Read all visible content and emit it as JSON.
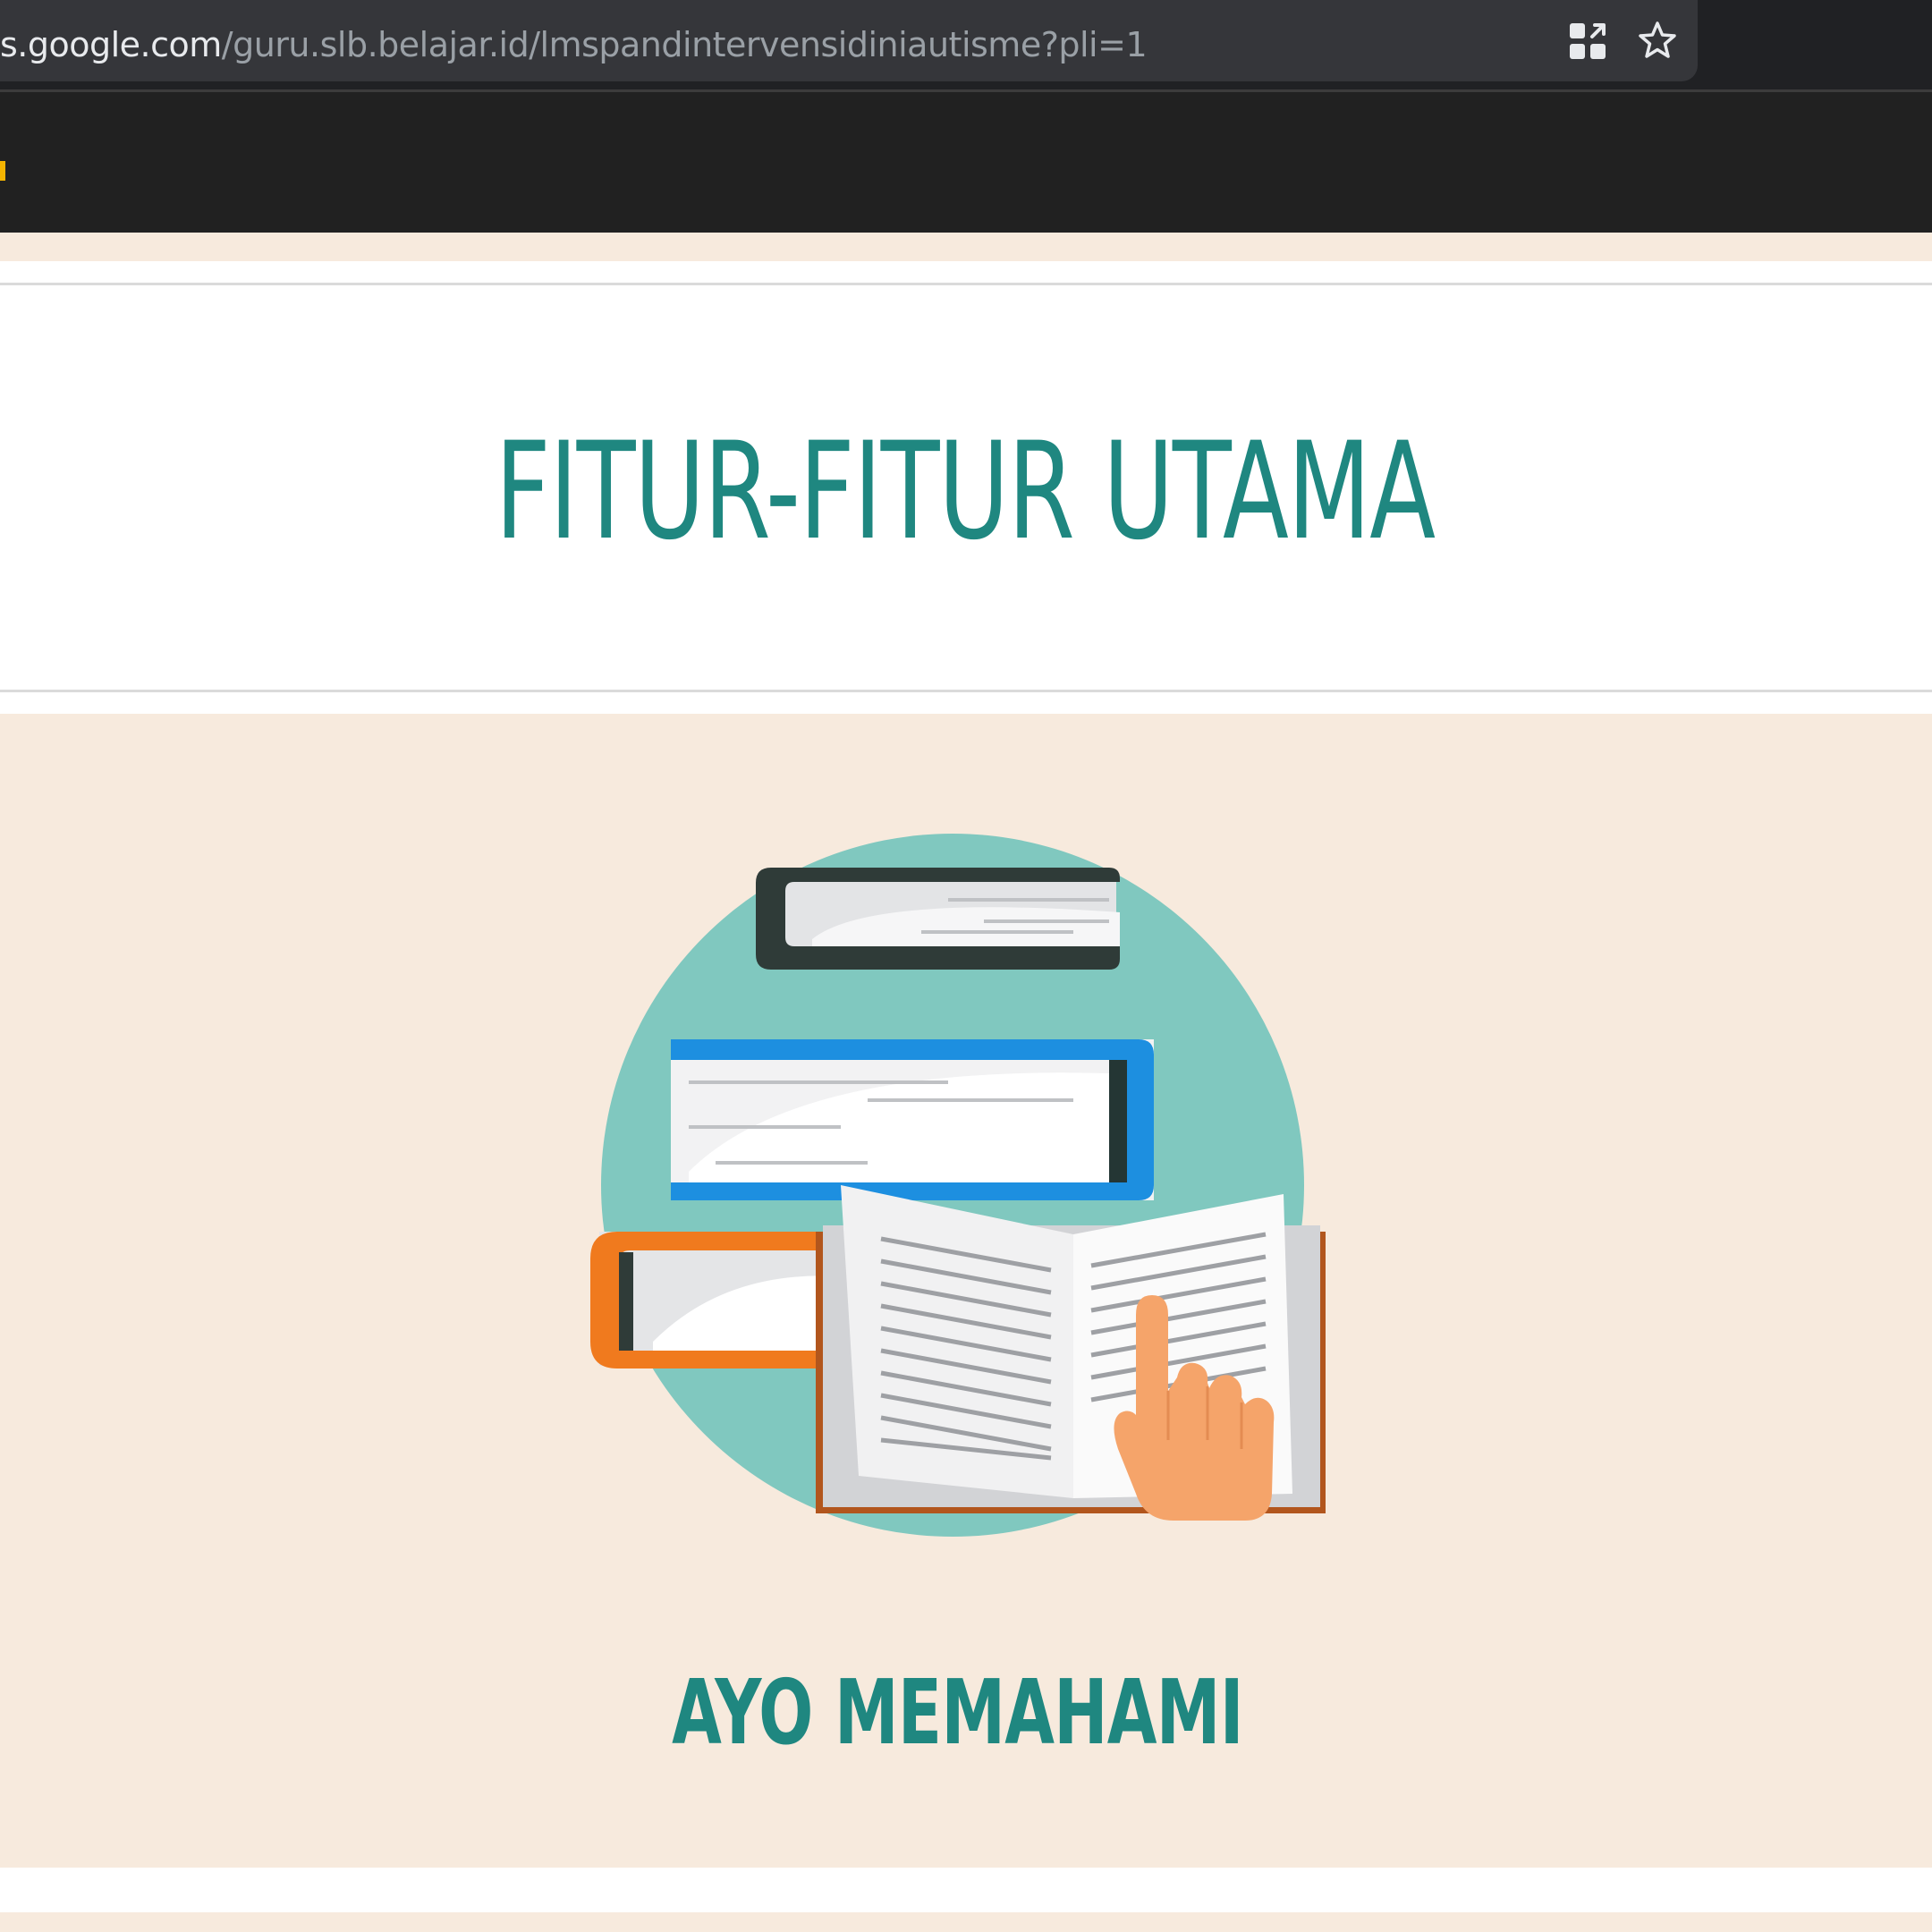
{
  "browser": {
    "url_domain": "s.google.com",
    "url_path": "/guru.slb.belajar.id/lmspandintervensidiniautisme?pli=1",
    "icons": [
      "install-app-icon",
      "bookmark-star-icon"
    ]
  },
  "section": {
    "title": "FITUR-FITUR UTAMA"
  },
  "feature": {
    "illustration": "books-reading-illustration",
    "label": "AYO MEMAHAMI"
  },
  "colors": {
    "accent_teal": "#1f8780",
    "background_beige": "#f7eadd",
    "header_dark": "#212121",
    "circle_teal": "#7fc7bf"
  }
}
